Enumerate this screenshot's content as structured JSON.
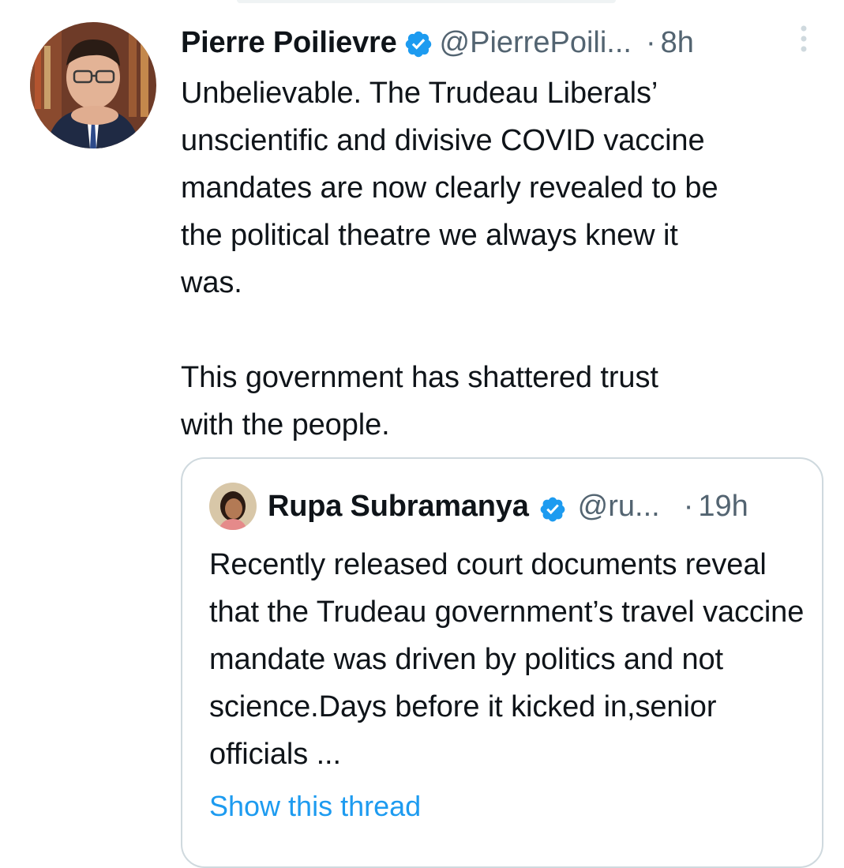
{
  "tweet": {
    "author_name": "Pierre Poilievre",
    "verified_icon": "verified-badge-icon",
    "handle": "@PierrePoili...",
    "separator": "·",
    "time": "8h",
    "more_icon": "more-options-icon",
    "text": "Unbelievable. The Trudeau Liberals’\nunscientific and divisive COVID vaccine\nmandates are now clearly revealed to be\nthe political theatre we always knew it\nwas.\n\nThis government has shattered trust\nwith the people."
  },
  "quote": {
    "author_name": "Rupa Subramanya",
    "verified_icon": "verified-badge-icon",
    "handle": "@ru...",
    "separator": "·",
    "time": "19h",
    "text": "Recently released court documents reveal that the Trudeau government’s travel vaccine mandate was driven by politics and not science.Days before it kicked in,senior officials ...",
    "show_thread_label": "Show this thread"
  },
  "colors": {
    "text_primary": "#0f1419",
    "text_secondary": "#536471",
    "accent": "#1d9bf0",
    "border": "#cfd9de"
  }
}
